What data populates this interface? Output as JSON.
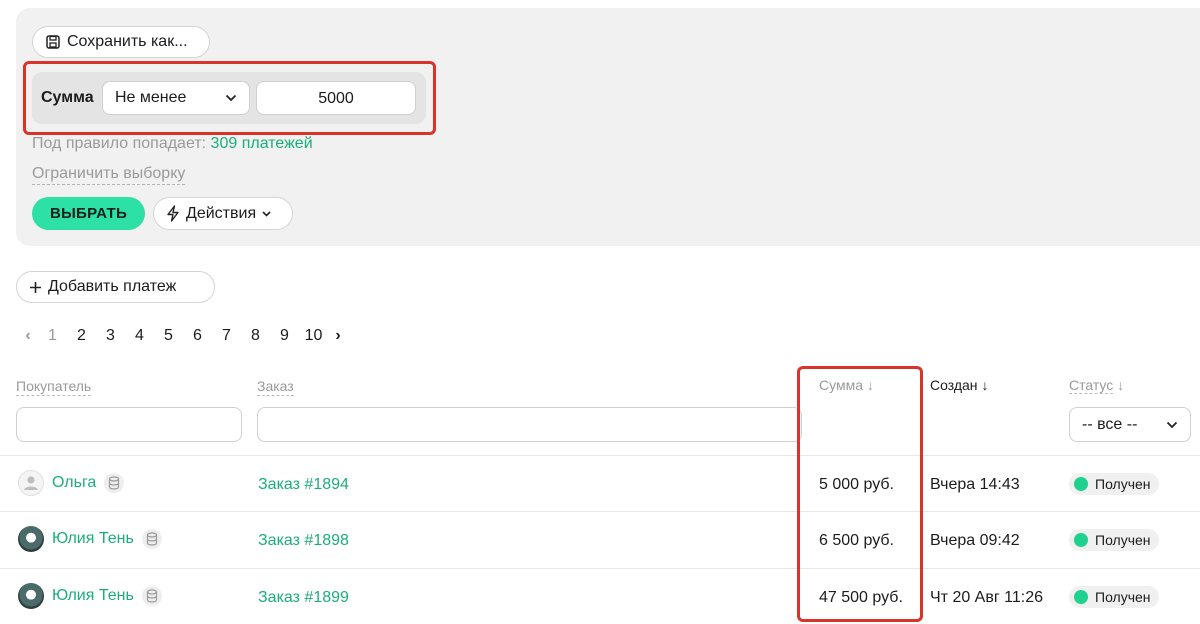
{
  "filter": {
    "save_label": "Сохранить как...",
    "rule": {
      "field": "Сумма",
      "operator": "Не менее",
      "value": "5000"
    },
    "match_prefix": "Под правило попадает:",
    "match_count": "309 платежей",
    "limit_label": "Ограничить выборку",
    "select_label": "ВЫБРАТЬ",
    "actions_label": "Действия"
  },
  "toolbar": {
    "add_payment_label": "Добавить платеж"
  },
  "pagination": {
    "current": "1",
    "pages": [
      "2",
      "3",
      "4",
      "5",
      "6",
      "7",
      "8",
      "9",
      "10"
    ]
  },
  "table": {
    "headers": {
      "buyer": "Покупатель",
      "order": "Заказ",
      "amount": "Сумма",
      "created": "Создан",
      "status": "Статус"
    },
    "status_filter": "-- все --",
    "rows": [
      {
        "buyer": "Ольга",
        "order": "Заказ #1894",
        "amount": "5 000 руб.",
        "created": "Вчера 14:43",
        "status": "Получен"
      },
      {
        "buyer": "Юлия Тень",
        "order": "Заказ #1898",
        "amount": "6 500 руб.",
        "created": "Вчера 09:42",
        "status": "Получен"
      },
      {
        "buyer": "Юлия Тень",
        "order": "Заказ #1899",
        "amount": "47 500 руб.",
        "created": "Чт 20 Авг 11:26",
        "status": "Получен"
      }
    ]
  },
  "colors": {
    "accent": "#1aae7c",
    "primary_button": "#2de0a5",
    "highlight": "#d9342b",
    "status_dot": "#1fd18f"
  }
}
